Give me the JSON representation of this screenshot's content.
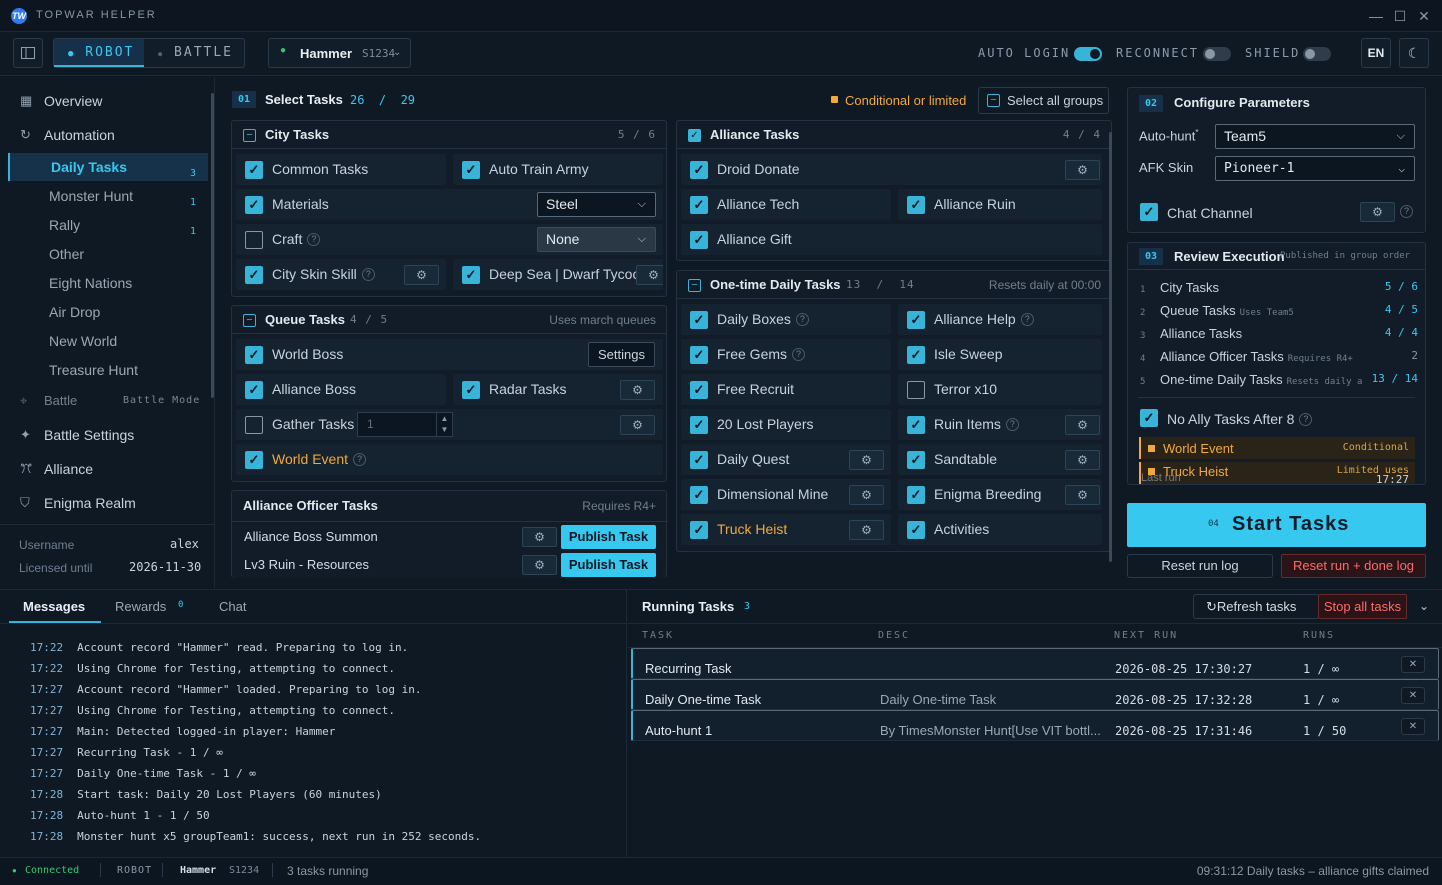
{
  "window": {
    "title": "TOPWAR HELPER",
    "logo": "TW"
  },
  "topbar": {
    "modes": [
      {
        "label": "ROBOT",
        "active": true
      },
      {
        "label": "BATTLE",
        "active": false
      }
    ],
    "account": {
      "name": "Hammer",
      "server": "S1234"
    },
    "auto_login": "AUTO LOGIN",
    "reconnect": "RECONNECT",
    "shield": "SHIELD",
    "language": "EN"
  },
  "sidebar": {
    "overview": "Overview",
    "automation": "Automation",
    "items": [
      {
        "label": "Daily Tasks",
        "badge": "3"
      },
      {
        "label": "Monster Hunt",
        "badge": "1"
      },
      {
        "label": "Rally",
        "badge": "1"
      },
      {
        "label": "Other",
        "badge": ""
      },
      {
        "label": "Eight Nations",
        "badge": ""
      },
      {
        "label": "Air Drop",
        "badge": ""
      },
      {
        "label": "New World",
        "badge": ""
      },
      {
        "label": "Treasure Hunt",
        "badge": ""
      }
    ],
    "battle": "Battle",
    "battle_mode": "Battle Mode",
    "battle_settings": "Battle Settings",
    "alliance": "Alliance",
    "enigma": "Enigma Realm",
    "username_label": "Username",
    "username": "alex",
    "licensed_label": "Licensed until",
    "licensed": "2026-11-30"
  },
  "select_tasks": {
    "num": "01",
    "title": "Select Tasks",
    "count": "26  /  29",
    "legend": "Conditional or limited",
    "select_all": "Select all groups"
  },
  "city": {
    "title": "City Tasks",
    "count": "5 / 6",
    "common": "Common Tasks",
    "auto_train": "Auto Train Army",
    "materials": "Materials",
    "materials_val": "Steel",
    "craft": "Craft",
    "craft_val": "None",
    "skin": "City Skin Skill",
    "deepsea": "Deep Sea | Dwarf Tycoon"
  },
  "queue": {
    "title": "Queue Tasks",
    "count": "4 / 5",
    "note": "Uses march queues",
    "world_boss": "World Boss",
    "settings": "Settings",
    "alliance_boss": "Alliance Boss",
    "radar": "Radar Tasks",
    "gather": "Gather Tasks",
    "gather_val": "1",
    "world_event": "World Event"
  },
  "officer": {
    "title": "Alliance Officer Tasks",
    "note": "Requires R4+",
    "rows": [
      {
        "label": "Alliance Boss Summon",
        "btn": "Publish Task"
      },
      {
        "label": "Lv3 Ruin - Resources",
        "btn": "Publish Task"
      }
    ]
  },
  "alliance": {
    "title": "Alliance Tasks",
    "count": "4 / 4",
    "droid": "Droid Donate",
    "tech": "Alliance Tech",
    "ruin": "Alliance Ruin",
    "gift": "Alliance Gift"
  },
  "onetime": {
    "title": "One-time Daily Tasks",
    "count": "13  /  14",
    "note": "Resets daily at 00:00",
    "items": [
      "Daily Boxes",
      "Alliance Help",
      "Free Gems",
      "Isle Sweep",
      "Free Recruit",
      "Terror x10",
      "20 Lost Players",
      "Ruin Items",
      "Daily Quest",
      "Sandtable",
      "Dimensional Mine",
      "Enigma Breeding",
      "Truck Heist",
      "Activities"
    ]
  },
  "configure": {
    "num": "02",
    "title": "Configure Parameters",
    "autohunt_label": "Auto-hunt",
    "autohunt_val": "Team5",
    "afk_label": "AFK Skin",
    "afk_val": "Pioneer-1",
    "chat": "Chat Channel"
  },
  "review": {
    "num": "03",
    "title": "Review Execution",
    "note": "Published in group order",
    "rows": [
      {
        "n": "1",
        "label": "City Tasks",
        "note": "",
        "val": "5 / 6"
      },
      {
        "n": "2",
        "label": "Queue Tasks",
        "note": "Uses Team5",
        "val": "4 / 5"
      },
      {
        "n": "3",
        "label": "Alliance Tasks",
        "note": "",
        "val": "4 / 4"
      },
      {
        "n": "4",
        "label": "Alliance Officer Tasks",
        "note": "Requires R4+",
        "val": "2"
      },
      {
        "n": "5",
        "label": "One-time Daily Tasks",
        "note": "Resets daily a",
        "val": "13 / 14"
      }
    ],
    "no_ally": "No Ally Tasks After 8",
    "world_event": "World Event",
    "world_event_tag": "Conditional",
    "truck": "Truck Heist",
    "truck_tag": "Limited uses",
    "last_run": "Last run",
    "last_run_time": "17:27"
  },
  "start": {
    "num": "04",
    "label": "Start Tasks"
  },
  "reset_log": "Reset run log",
  "reset_done": "Reset run + done log",
  "messages": {
    "tabs": [
      {
        "label": "Messages"
      },
      {
        "label": "Rewards",
        "badge": "0"
      },
      {
        "label": "Chat"
      }
    ],
    "logs": [
      {
        "t": "17:22",
        "m": "Account record \"Hammer\" read. Preparing to log in."
      },
      {
        "t": "17:22",
        "m": "Using Chrome for Testing, attempting to connect."
      },
      {
        "t": "17:27",
        "m": "Account record \"Hammer\" loaded. Preparing to log in."
      },
      {
        "t": "17:27",
        "m": "Using Chrome for Testing, attempting to connect."
      },
      {
        "t": "17:27",
        "m": "Main: Detected logged-in player: Hammer"
      },
      {
        "t": "17:27",
        "m": "Recurring Task - 1 / ∞"
      },
      {
        "t": "17:27",
        "m": "Daily One-time Task - 1 / ∞"
      },
      {
        "t": "17:28",
        "m": "Start task: Daily 20 Lost Players (60 minutes)"
      },
      {
        "t": "17:28",
        "m": "Auto-hunt 1 - 1 / 50"
      },
      {
        "t": "17:28",
        "m": "Monster hunt x5 groupTeam1: success, next run in 252 seconds."
      }
    ]
  },
  "running": {
    "title": "Running Tasks",
    "count": "3",
    "refresh": "Refresh tasks",
    "stop": "Stop all tasks",
    "cols": [
      "TASK",
      "DESC",
      "NEXT RUN",
      "RUNS"
    ],
    "rows": [
      {
        "task": "Recurring Task",
        "desc": "",
        "next": "2026-08-25 17:30:27",
        "runs": "1 / ∞"
      },
      {
        "task": "Daily One-time Task",
        "desc": "Daily One-time Task",
        "next": "2026-08-25 17:32:28",
        "runs": "1 / ∞"
      },
      {
        "task": "Auto-hunt 1",
        "desc": "By TimesMonster Hunt[Use VIT bottl...",
        "next": "2026-08-25 17:31:46",
        "runs": "1 / 50"
      }
    ]
  },
  "status": {
    "connected": "Connected",
    "mode": "ROBOT",
    "account": "Hammer",
    "server": "S1234",
    "running": "3 tasks running",
    "right": "09:31:12 Daily tasks – alliance gifts claimed"
  },
  "colors": {
    "accent": "#37b4d8",
    "accent_bright": "#37c8ef",
    "warning": "#f2a93b",
    "danger": "#e05050",
    "success": "#2ecc71"
  }
}
